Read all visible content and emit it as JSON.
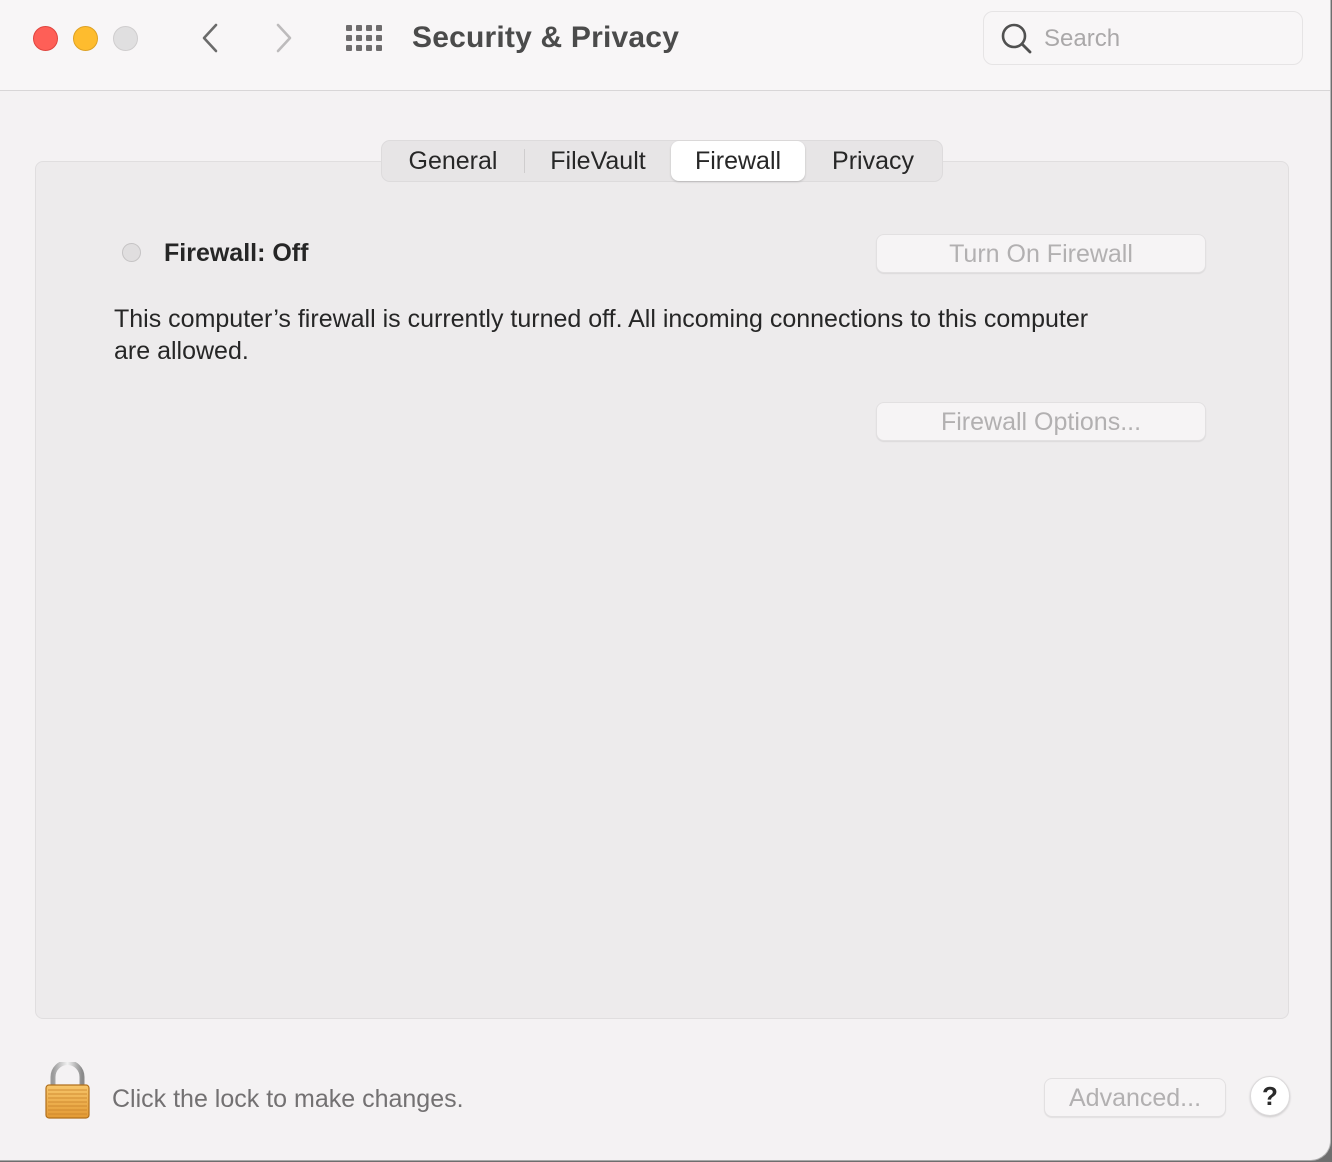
{
  "window": {
    "title": "Security & Privacy",
    "traffic_lights": {
      "close_color": "#fe5f57",
      "minimize_color": "#febc2e",
      "maximize_color": "#e0dfe0"
    },
    "nav": {
      "back_icon": "chevron-left-icon",
      "forward_icon": "chevron-right-icon",
      "show_all_icon": "grid-icon"
    },
    "search": {
      "icon": "search-icon",
      "value": "",
      "placeholder": "Search"
    }
  },
  "tabs": [
    {
      "label": "General",
      "selected": false
    },
    {
      "label": "FileVault",
      "selected": false
    },
    {
      "label": "Firewall",
      "selected": true
    },
    {
      "label": "Privacy",
      "selected": false
    }
  ],
  "firewall": {
    "status_label": "Firewall: Off",
    "status_indicator_color": "#e0dedf",
    "turn_on_button": "Turn On Firewall",
    "description": "This computer’s firewall is currently turned off. All incoming connections to this computer are allowed.",
    "options_button": "Firewall Options..."
  },
  "footer": {
    "lock_icon": "lock-icon",
    "lock_text": "Click the lock to make changes.",
    "advanced_button": "Advanced...",
    "help_button": "?"
  }
}
